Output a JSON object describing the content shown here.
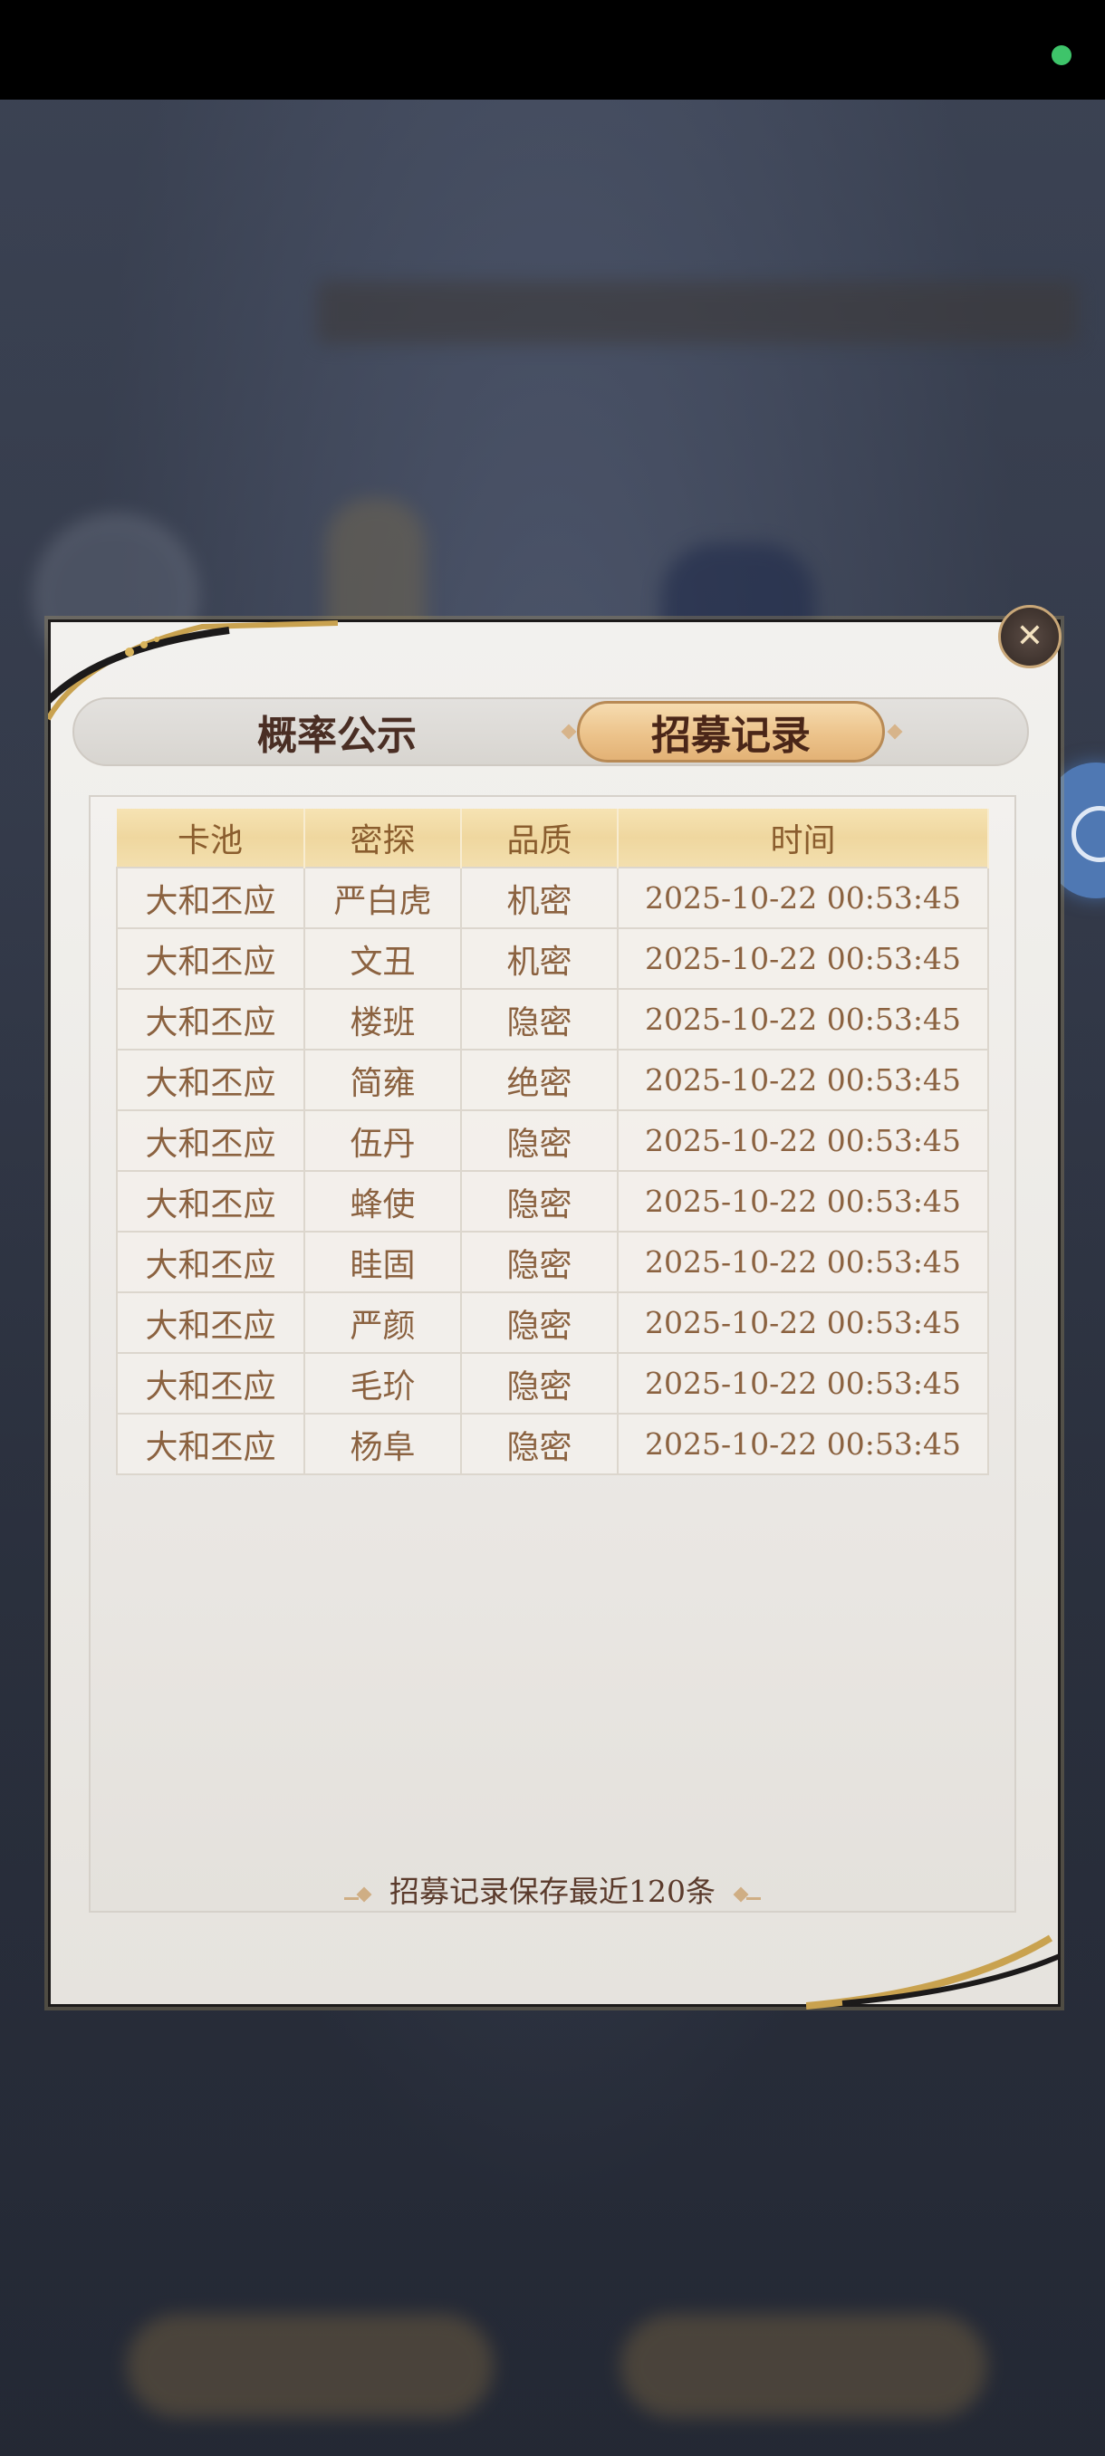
{
  "tabs": {
    "probability": "概率公示",
    "history": "招募记录"
  },
  "table": {
    "headers": [
      "卡池",
      "密探",
      "品质",
      "时间"
    ],
    "rows": [
      {
        "pool": "大和丕应",
        "agent": "严白虎",
        "quality": "机密",
        "time": "2025-10-22 00:53:45"
      },
      {
        "pool": "大和丕应",
        "agent": "文丑",
        "quality": "机密",
        "time": "2025-10-22 00:53:45"
      },
      {
        "pool": "大和丕应",
        "agent": "楼班",
        "quality": "隐密",
        "time": "2025-10-22 00:53:45"
      },
      {
        "pool": "大和丕应",
        "agent": "简雍",
        "quality": "绝密",
        "time": "2025-10-22 00:53:45"
      },
      {
        "pool": "大和丕应",
        "agent": "伍丹",
        "quality": "隐密",
        "time": "2025-10-22 00:53:45"
      },
      {
        "pool": "大和丕应",
        "agent": "蜂使",
        "quality": "隐密",
        "time": "2025-10-22 00:53:45"
      },
      {
        "pool": "大和丕应",
        "agent": "眭固",
        "quality": "隐密",
        "time": "2025-10-22 00:53:45"
      },
      {
        "pool": "大和丕应",
        "agent": "严颜",
        "quality": "隐密",
        "time": "2025-10-22 00:53:45"
      },
      {
        "pool": "大和丕应",
        "agent": "毛玠",
        "quality": "隐密",
        "time": "2025-10-22 00:53:45"
      },
      {
        "pool": "大和丕应",
        "agent": "杨阜",
        "quality": "隐密",
        "time": "2025-10-22 00:53:45"
      }
    ]
  },
  "footer": {
    "note": "招募记录保存最近120条"
  },
  "colors": {
    "quality_jimi": "#8c76b8",
    "quality_yinmi": "#78a4cc",
    "quality_juemi": "#c2582a",
    "accent_gold": "#ecc38b"
  },
  "icons": {
    "close": "close-icon"
  }
}
